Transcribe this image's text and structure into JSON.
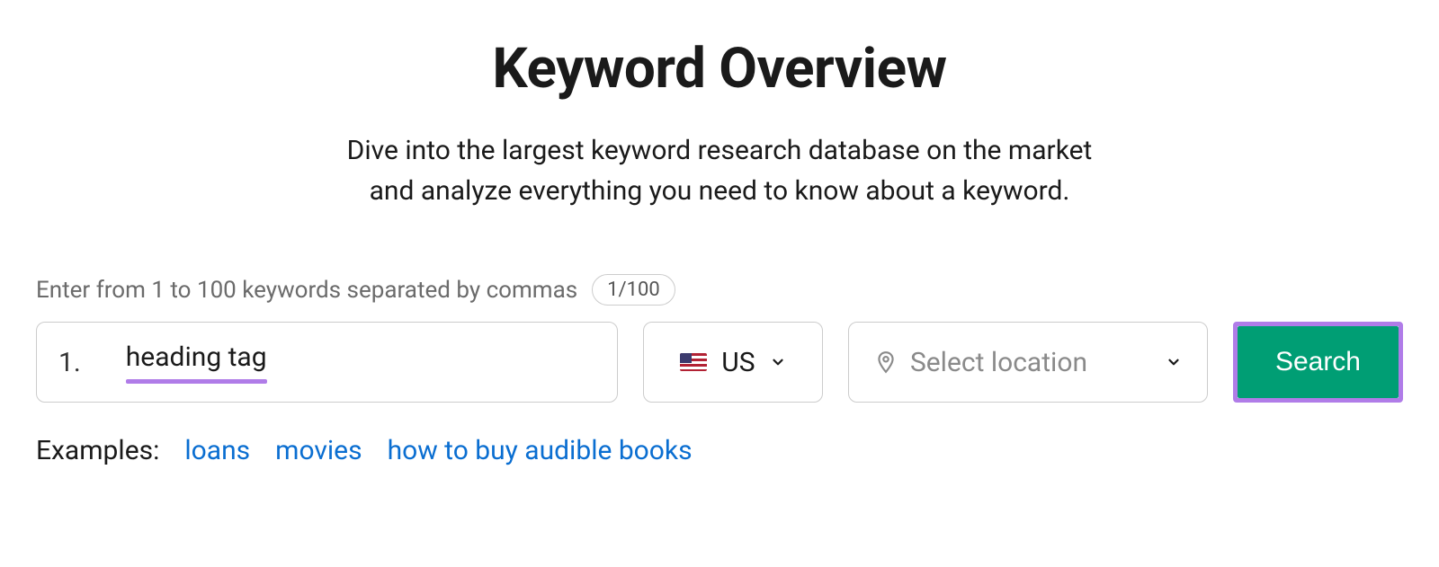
{
  "header": {
    "title": "Keyword Overview",
    "subtitle_line1": "Dive into the largest keyword research database on the market",
    "subtitle_line2": "and analyze everything you need to know about a keyword."
  },
  "form": {
    "hint": "Enter from 1 to 100 keywords separated by commas",
    "count_badge": "1/100",
    "keyword_number": "1.",
    "keyword_value": "heading tag",
    "country": {
      "code": "US",
      "label": "US"
    },
    "location_placeholder": "Select location",
    "search_label": "Search"
  },
  "examples": {
    "label": "Examples:",
    "links": [
      "loans",
      "movies",
      "how to buy audible books"
    ]
  }
}
